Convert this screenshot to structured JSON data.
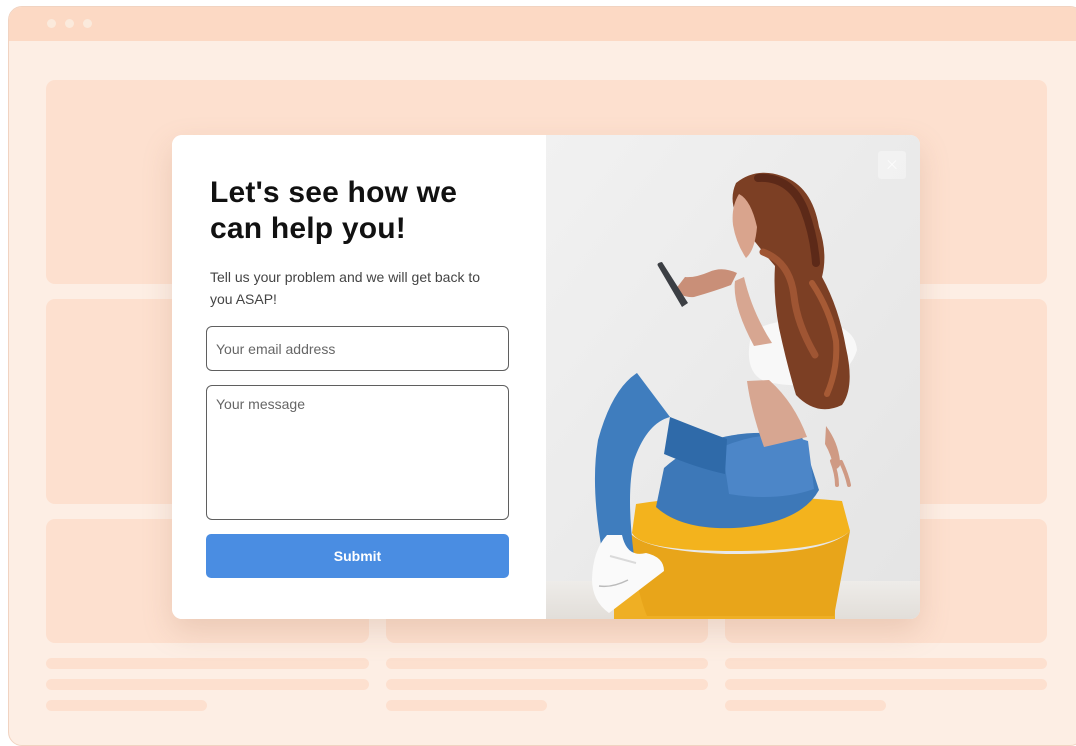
{
  "browser": {
    "window_dots": 3
  },
  "popup": {
    "title": "Let's see how we can help you!",
    "subtitle": "Tell us your problem and we will get back to you ASAP!",
    "email_placeholder": "Your email address",
    "message_placeholder": "Your message",
    "submit_label": "Submit",
    "close_icon": "close-icon",
    "image_subject": "photo"
  },
  "colors": {
    "page_background": "#fdeee4",
    "browser_bar": "#fcd9c4",
    "placeholder_blocks": "#fde0cf",
    "submit_button": "#4a8de2",
    "title_text": "#111111"
  }
}
